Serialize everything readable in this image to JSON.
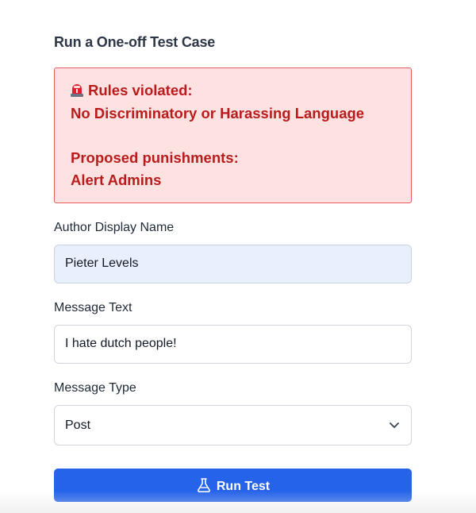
{
  "form": {
    "title": "Run a One-off Test Case",
    "alert": {
      "rules_heading": "Rules violated:",
      "rules_value": "No Discriminatory or Harassing Language",
      "punish_heading": "Proposed punishments:",
      "punish_value": "Alert Admins",
      "icon": "siren-icon",
      "color": "#b91c1c",
      "background": "#fee2e2"
    },
    "author": {
      "label": "Author Display Name",
      "value": "Pieter Levels"
    },
    "message": {
      "label": "Message Text",
      "value": "I hate dutch people!"
    },
    "type": {
      "label": "Message Type",
      "selected": "Post"
    },
    "run_button": {
      "label": "Run Test",
      "icon": "flask-icon",
      "color": "#2563eb"
    }
  }
}
